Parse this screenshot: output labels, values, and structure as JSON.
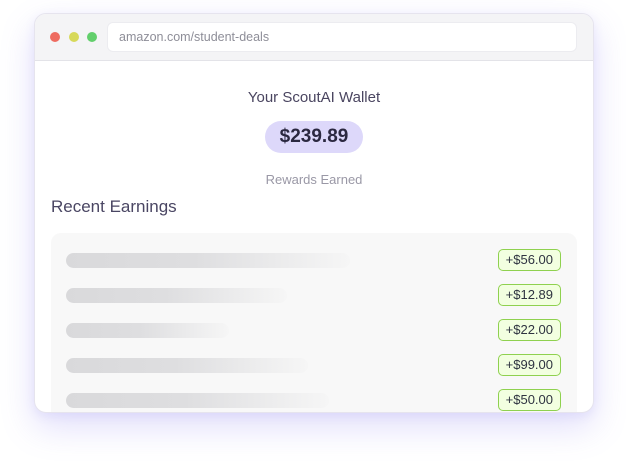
{
  "browser": {
    "url": "amazon.com/student-deals",
    "dots": {
      "red": "#ee6b60",
      "yellow": "#d7d95a",
      "green": "#62cf6c"
    }
  },
  "wallet": {
    "title": "Your ScoutAI Wallet",
    "balance": "$239.89",
    "balance_label": "Rewards Earned"
  },
  "recent": {
    "title": "Recent Earnings",
    "items": [
      {
        "amount": "+$56.00",
        "placeholder_level": 0.54
      },
      {
        "amount": "+$12.89",
        "placeholder_level": 0.42
      },
      {
        "amount": "+$22.00",
        "placeholder_level": 0.31
      },
      {
        "amount": "+$99.00",
        "placeholder_level": 0.46
      },
      {
        "amount": "+$50.00",
        "placeholder_level": 0.5
      }
    ]
  },
  "colors": {
    "accent": "#ddd8fa",
    "badge_border": "#8fd14f",
    "badge_bg": "#f2ffe0"
  }
}
